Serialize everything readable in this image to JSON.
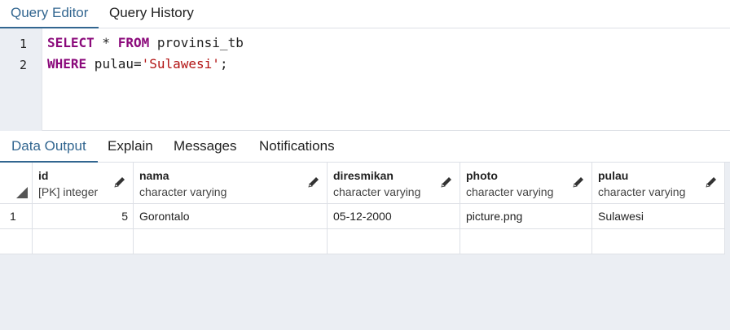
{
  "editor_tabs": [
    {
      "label": "Query Editor",
      "active": true
    },
    {
      "label": "Query History",
      "active": false
    }
  ],
  "editor": {
    "line_numbers": [
      "1",
      "2"
    ],
    "line1": {
      "kw1": "SELECT",
      "mid": " * ",
      "kw2": "FROM",
      "rest": " provinsi_tb"
    },
    "line2": {
      "kw1": "WHERE",
      "mid": " pulau=",
      "str": "'Sulawesi'",
      "rest": ";"
    }
  },
  "result_tabs": [
    {
      "label": "Data Output",
      "active": true
    },
    {
      "label": "Explain",
      "active": false
    },
    {
      "label": "Messages",
      "active": false
    },
    {
      "label": "Notifications",
      "active": false
    }
  ],
  "grid": {
    "columns": [
      {
        "name": "id",
        "type": "[PK] integer"
      },
      {
        "name": "nama",
        "type": "character varying"
      },
      {
        "name": "diresmikan",
        "type": "character varying"
      },
      {
        "name": "photo",
        "type": "character varying"
      },
      {
        "name": "pulau",
        "type": "character varying"
      }
    ],
    "rows": [
      {
        "rownum": "1",
        "id": "5",
        "nama": "Gorontalo",
        "diresmikan": "05-12-2000",
        "photo": "picture.png",
        "pulau": "Sulawesi"
      }
    ]
  },
  "colors": {
    "accent": "#326690",
    "keyword": "#8b0a7b",
    "string": "#b21313",
    "panel_bg": "#ebeef3"
  },
  "icons": {
    "edit": "pencil-icon",
    "select_all": "corner-triangle-icon"
  }
}
